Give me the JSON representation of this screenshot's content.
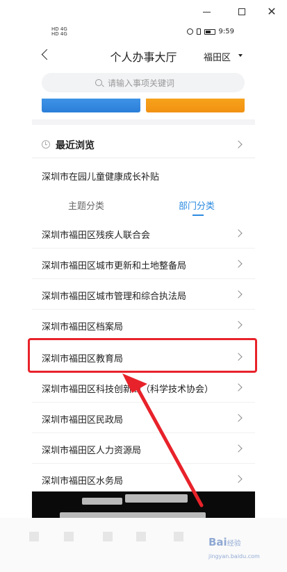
{
  "window": {
    "controls": [
      "minimize-icon",
      "maximize-icon",
      "close-icon"
    ]
  },
  "status_bar": {
    "left_lines": [
      "HD 4G",
      "HD 4G"
    ],
    "time": "9:59"
  },
  "header": {
    "title": "个人办事大厅",
    "district": "福田区"
  },
  "search": {
    "placeholder": "请输入事项关键词"
  },
  "recent": {
    "label": "最近浏览",
    "item": "深圳市在园儿童健康成长补贴"
  },
  "tabs": [
    {
      "label": "主题分类",
      "active": false
    },
    {
      "label": "部门分类",
      "active": true
    }
  ],
  "departments": [
    "深圳市福田区残疾人联合会",
    "深圳市福田区城市更新和土地整备局",
    "深圳市福田区城市管理和综合执法局",
    "深圳市福田区档案局",
    "深圳市福田区教育局",
    "深圳市福田区科技创新局（科学技术协会）",
    "深圳市福田区民政局",
    "深圳市福田区人力资源局",
    "深圳市福田区水务局"
  ],
  "highlighted_department_index": 4,
  "colors": {
    "accent": "#2a8ae0",
    "annotation": "#e8222a",
    "banner_blue": "#3e93e6",
    "banner_orange": "#f6a21c"
  },
  "watermark": {
    "brand": "Bai",
    "suffix": "经验",
    "domain": "jingyan.baidu.com"
  }
}
